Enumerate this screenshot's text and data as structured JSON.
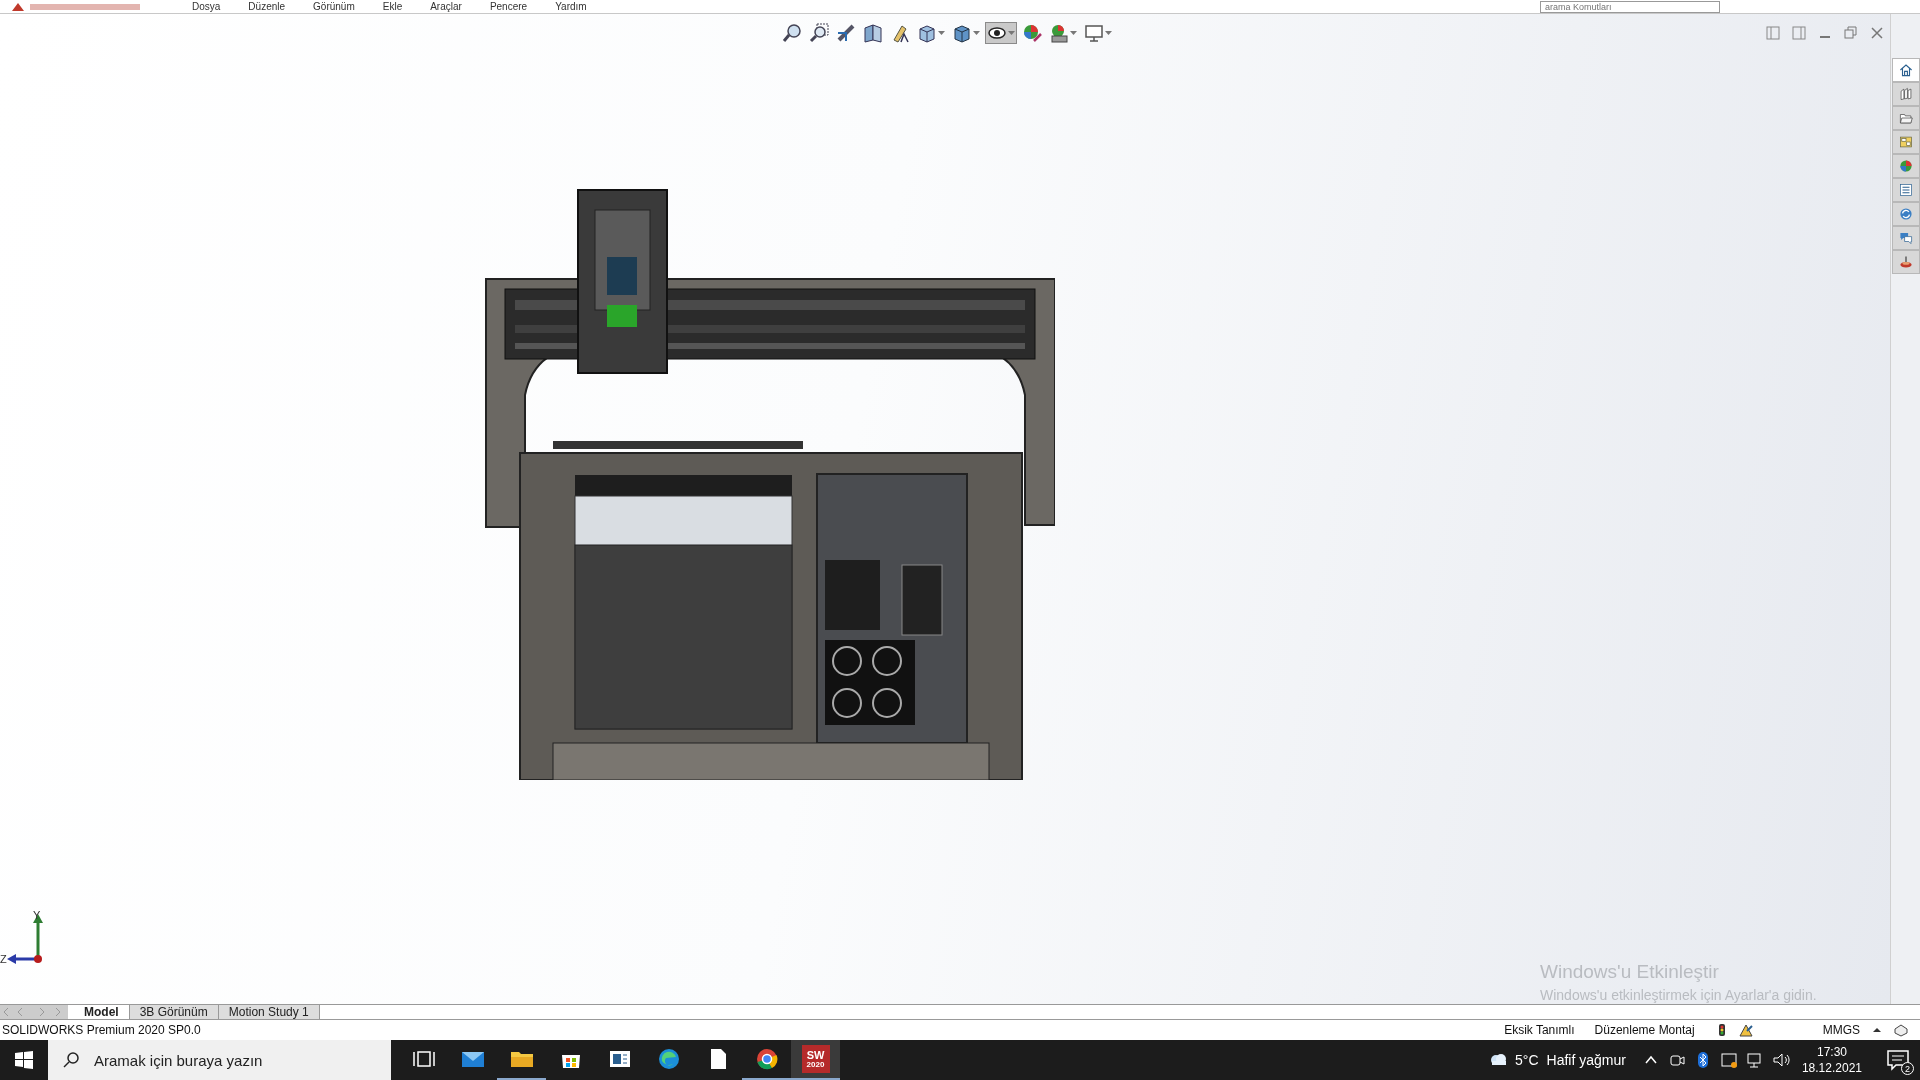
{
  "menu_bar": {
    "items": [
      "Dosya",
      "Düzenle",
      "Görünüm",
      "Ekle",
      "Araçlar",
      "Pencere",
      "Yardım"
    ],
    "search": {
      "placeholder": "arama Komutları"
    }
  },
  "view_toolbar": [
    {
      "kind": "zoom-fit",
      "dropdown": false,
      "selected": false
    },
    {
      "kind": "zoom-area",
      "dropdown": false,
      "selected": false
    },
    {
      "kind": "previous-view",
      "dropdown": false,
      "selected": false
    },
    {
      "kind": "section-view",
      "dropdown": false,
      "selected": false
    },
    {
      "kind": "annotation-view",
      "dropdown": false,
      "selected": false
    },
    {
      "kind": "view-orientation",
      "dropdown": true,
      "selected": false
    },
    {
      "kind": "display-style",
      "dropdown": true,
      "selected": false
    },
    {
      "kind": "hide-show",
      "dropdown": true,
      "selected": true
    },
    {
      "kind": "edit-appearance",
      "dropdown": false,
      "selected": false
    },
    {
      "kind": "apply-scene",
      "dropdown": true,
      "selected": false
    },
    {
      "kind": "view-settings",
      "dropdown": true,
      "selected": false
    }
  ],
  "task_pane": [
    {
      "kind": "home",
      "selected": true
    },
    {
      "kind": "library",
      "selected": false
    },
    {
      "kind": "folder",
      "selected": false
    },
    {
      "kind": "palette",
      "selected": false
    },
    {
      "kind": "appearance",
      "selected": false
    },
    {
      "kind": "properties",
      "selected": false
    },
    {
      "kind": "refresh",
      "selected": false
    },
    {
      "kind": "forum",
      "selected": false
    },
    {
      "kind": "plugin",
      "selected": false
    }
  ],
  "triad": {
    "y_label": "Y",
    "z_label": "Z"
  },
  "watermark": {
    "title": "Windows'u Etkinleştir",
    "subtitle": "Windows'u etkinleştirmek için Ayarlar'a gidin."
  },
  "model_tabs": [
    {
      "label": "Model",
      "selected": true
    },
    {
      "label": "3B Görünüm",
      "selected": false
    },
    {
      "label": "Motion Study 1",
      "selected": false
    }
  ],
  "status_bar": {
    "product": "SOLIDWORKS Premium 2020 SP0.0",
    "definition": "Eksik Tanımlı",
    "mode": "Düzenleme Montaj",
    "units": "MMGS"
  },
  "taskbar": {
    "search": {
      "placeholder": "Aramak için buraya yazın"
    },
    "apps": [
      {
        "kind": "task-view",
        "running": false,
        "active": false
      },
      {
        "kind": "mail",
        "running": false,
        "active": false
      },
      {
        "kind": "explorer",
        "running": true,
        "active": false
      },
      {
        "kind": "store",
        "running": false,
        "active": false
      },
      {
        "kind": "news",
        "running": false,
        "active": false
      },
      {
        "kind": "edge",
        "running": false,
        "active": false
      },
      {
        "kind": "file",
        "running": false,
        "active": false
      },
      {
        "kind": "chrome",
        "running": true,
        "active": false
      },
      {
        "kind": "solidworks",
        "running": true,
        "active": true,
        "logo_text": "SW",
        "version": "2020"
      }
    ],
    "weather": {
      "temperature": "5°C",
      "condition": "Hafif yağmur"
    },
    "clock": {
      "time": "17:30",
      "date": "18.12.2021"
    },
    "notifications": {
      "count": "2"
    }
  }
}
